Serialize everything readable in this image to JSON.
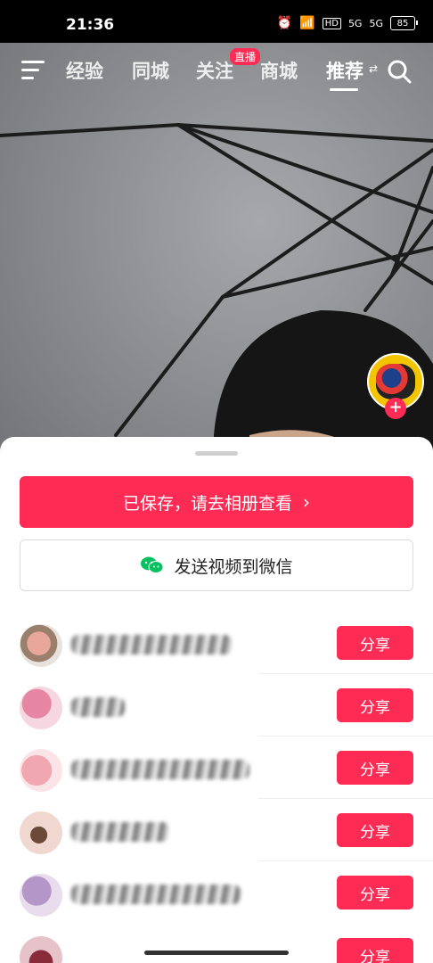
{
  "status_bar": {
    "time": "21:36",
    "network1": "5G",
    "network2": "5G",
    "battery": "85",
    "hd": "HD"
  },
  "top_nav": {
    "tabs": [
      {
        "label": "经验"
      },
      {
        "label": "同城"
      },
      {
        "label": "关注"
      },
      {
        "label": "商城"
      },
      {
        "label": "推荐"
      }
    ],
    "live_badge": "直播",
    "active_tab": "推荐"
  },
  "sheet": {
    "saved_label": "已保存，请去相册查看",
    "wechat_label": "发送视频到微信",
    "contacts": [
      {
        "share_label": "分享"
      },
      {
        "share_label": "分享"
      },
      {
        "share_label": "分享"
      },
      {
        "share_label": "分享"
      },
      {
        "share_label": "分享"
      },
      {
        "share_label": "分享"
      }
    ]
  },
  "colors": {
    "accent": "#fe2c55",
    "wechat": "#07c160"
  }
}
